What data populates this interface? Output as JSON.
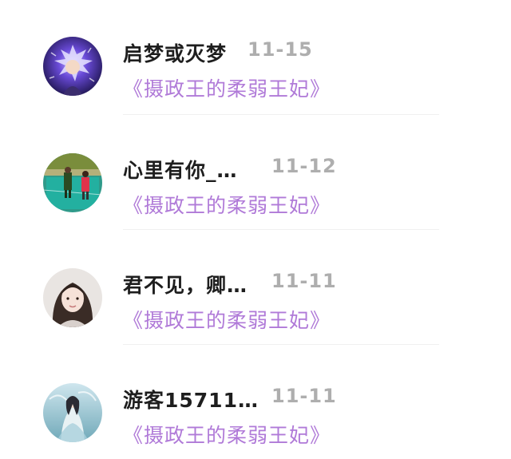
{
  "comments": [
    {
      "username": "启梦或灭梦",
      "date": "11-15",
      "book_title": "《摄政王的柔弱王妃》",
      "avatar": "anime-character-avatar"
    },
    {
      "username": "心里有你_…",
      "date": "11-12",
      "book_title": "《摄政王的柔弱王妃》",
      "avatar": "children-playground-photo-avatar"
    },
    {
      "username": "君不见，卿…",
      "date": "11-11",
      "book_title": "《摄政王的柔弱王妃》",
      "avatar": "woman-portrait-avatar"
    },
    {
      "username": "游客15711…",
      "date": "11-11",
      "book_title": "《摄政王的柔弱王妃》",
      "avatar": "fantasy-character-avatar"
    }
  ],
  "colors": {
    "username": "#1e1e1e",
    "date": "#aeaeae",
    "book_title": "#b07ad8",
    "divider": "#f0f0f0"
  }
}
